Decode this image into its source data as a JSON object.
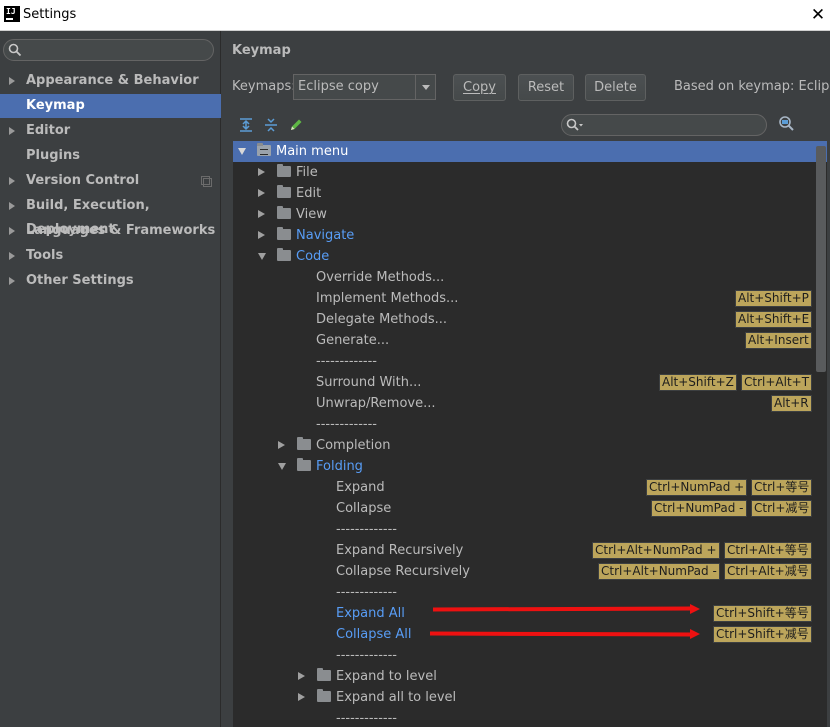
{
  "window": {
    "title": "Settings",
    "app_icon": "IJ",
    "close_glyph": "✕"
  },
  "sidebar": {
    "items": [
      {
        "label": "Appearance & Behavior",
        "expandable": true,
        "selected": false
      },
      {
        "label": "Keymap",
        "expandable": false,
        "selected": true
      },
      {
        "label": "Editor",
        "expandable": true,
        "selected": false
      },
      {
        "label": "Plugins",
        "expandable": false,
        "selected": false
      },
      {
        "label": "Version Control",
        "expandable": true,
        "selected": false
      },
      {
        "label": "Build, Execution, Deployment",
        "expandable": true,
        "selected": false
      },
      {
        "label": "Languages & Frameworks",
        "expandable": true,
        "selected": false
      },
      {
        "label": "Tools",
        "expandable": true,
        "selected": false
      },
      {
        "label": "Other Settings",
        "expandable": true,
        "selected": false
      }
    ]
  },
  "main": {
    "heading": "Keymap",
    "keymaps_label": "Keymaps:",
    "keymap_selected": "Eclipse copy",
    "buttons": {
      "copy": "Copy",
      "reset": "Reset",
      "delete": "Delete"
    },
    "based_on": "Based on keymap: Eclipse"
  },
  "tree": {
    "rows": [
      {
        "text": "Main menu",
        "level": 0,
        "twisty": "open",
        "folder": "menu",
        "selected": true
      },
      {
        "text": "File",
        "level": 1,
        "twisty": "closed",
        "folder": "folder"
      },
      {
        "text": "Edit",
        "level": 1,
        "twisty": "closed",
        "folder": "folder"
      },
      {
        "text": "View",
        "level": 1,
        "twisty": "closed",
        "folder": "folder"
      },
      {
        "text": "Navigate",
        "level": 1,
        "twisty": "closed",
        "folder": "folder",
        "highlight": true
      },
      {
        "text": "Code",
        "level": 1,
        "twisty": "open",
        "folder": "folder",
        "highlight": true
      },
      {
        "text": "Override Methods...",
        "level": 2
      },
      {
        "text": "Implement Methods...",
        "level": 2,
        "shortcuts": [
          "Alt+Shift+P"
        ]
      },
      {
        "text": "Delegate Methods...",
        "level": 2,
        "shortcuts": [
          "Alt+Shift+E"
        ]
      },
      {
        "text": "Generate...",
        "level": 2,
        "shortcuts": [
          "Alt+Insert"
        ]
      },
      {
        "text": "-------------",
        "level": 2
      },
      {
        "text": "Surround With...",
        "level": 2,
        "shortcuts": [
          "Alt+Shift+Z",
          "Ctrl+Alt+T"
        ]
      },
      {
        "text": "Unwrap/Remove...",
        "level": 2,
        "shortcuts": [
          "Alt+R"
        ]
      },
      {
        "text": "-------------",
        "level": 2
      },
      {
        "text": "Completion",
        "level": 2,
        "twisty": "closed",
        "folder": "folder"
      },
      {
        "text": "Folding",
        "level": 2,
        "twisty": "open",
        "folder": "folder",
        "highlight": true
      },
      {
        "text": "Expand",
        "level": 3,
        "shortcuts": [
          "Ctrl+NumPad +",
          "Ctrl+等号"
        ]
      },
      {
        "text": "Collapse",
        "level": 3,
        "shortcuts": [
          "Ctrl+NumPad -",
          "Ctrl+减号"
        ]
      },
      {
        "text": "-------------",
        "level": 3
      },
      {
        "text": "Expand Recursively",
        "level": 3,
        "shortcuts": [
          "Ctrl+Alt+NumPad +",
          "Ctrl+Alt+等号"
        ]
      },
      {
        "text": "Collapse Recursively",
        "level": 3,
        "shortcuts": [
          "Ctrl+Alt+NumPad -",
          "Ctrl+Alt+减号"
        ]
      },
      {
        "text": "-------------",
        "level": 3
      },
      {
        "text": "Expand All",
        "level": 3,
        "highlight": true,
        "shortcuts": [
          "Ctrl+Shift+等号"
        ],
        "annotated": true
      },
      {
        "text": "Collapse All",
        "level": 3,
        "highlight": true,
        "shortcuts": [
          "Ctrl+Shift+减号"
        ],
        "annotated": true
      },
      {
        "text": "-------------",
        "level": 3
      },
      {
        "text": "Expand to level",
        "level": 3,
        "twisty": "closed",
        "folder": "folder"
      },
      {
        "text": "Expand all to level",
        "level": 3,
        "twisty": "closed",
        "folder": "folder"
      },
      {
        "text": "-------------",
        "level": 3
      }
    ]
  },
  "colors": {
    "selection": "#4b6eaf",
    "link": "#589df6",
    "shortcut_bg": "#bca55b",
    "annotation": "#ee1111"
  }
}
